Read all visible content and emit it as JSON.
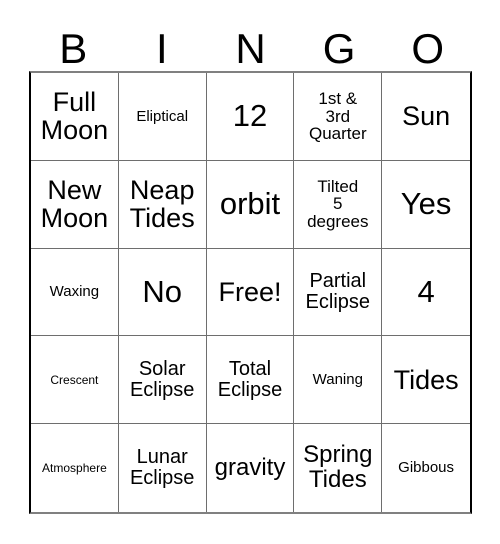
{
  "card": {
    "title": "BINGO",
    "headers": [
      "B",
      "I",
      "N",
      "G",
      "O"
    ],
    "rows": [
      [
        {
          "text": "Full\nMoon",
          "size": "xl"
        },
        {
          "text": "Eliptical",
          "size": "xs"
        },
        {
          "text": "12",
          "size": "xxl"
        },
        {
          "text": "1st &\n3rd\nQuarter",
          "size": "sm"
        },
        {
          "text": "Sun",
          "size": "xl"
        }
      ],
      [
        {
          "text": "New\nMoon",
          "size": "xl"
        },
        {
          "text": "Neap\nTides",
          "size": "xl"
        },
        {
          "text": "orbit",
          "size": "xxl"
        },
        {
          "text": "Tilted\n5\ndegrees",
          "size": "sm"
        },
        {
          "text": "Yes",
          "size": "xxl"
        }
      ],
      [
        {
          "text": "Waxing",
          "size": "xs"
        },
        {
          "text": "No",
          "size": "xxl"
        },
        {
          "text": "Free!",
          "size": "xl"
        },
        {
          "text": "Partial\nEclipse",
          "size": "md"
        },
        {
          "text": "4",
          "size": "xxl"
        }
      ],
      [
        {
          "text": "Crescent",
          "size": "xxs"
        },
        {
          "text": "Solar\nEclipse",
          "size": "md"
        },
        {
          "text": "Total\nEclipse",
          "size": "md"
        },
        {
          "text": "Waning",
          "size": "xs"
        },
        {
          "text": "Tides",
          "size": "xl"
        }
      ],
      [
        {
          "text": "Atmosphere",
          "size": "xxs"
        },
        {
          "text": "Lunar\nEclipse",
          "size": "md"
        },
        {
          "text": "gravity",
          "size": "lg"
        },
        {
          "text": "Spring\nTides",
          "size": "lg"
        },
        {
          "text": "Gibbous",
          "size": "xs"
        }
      ]
    ],
    "free_space": {
      "row": 2,
      "col": 2,
      "label": "Free!"
    },
    "colors": {
      "background": "#ffffff",
      "text": "#000000",
      "grid_line": "#6e6e6e",
      "outer_border": "#000000"
    }
  }
}
